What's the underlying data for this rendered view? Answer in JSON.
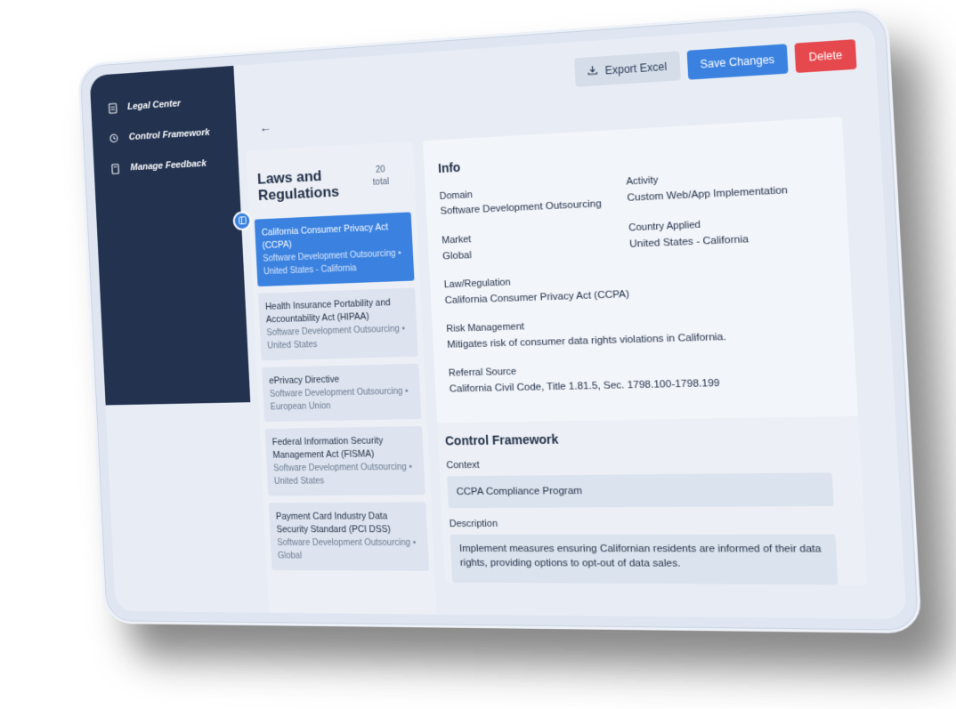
{
  "sidebar": {
    "items": [
      {
        "label": "Legal Center",
        "icon": "document-icon"
      },
      {
        "label": "Control Framework",
        "icon": "history-icon"
      },
      {
        "label": "Manage Feedback",
        "icon": "feedback-icon"
      }
    ]
  },
  "toolbar": {
    "export_label": "Export Excel",
    "save_label": "Save Changes",
    "delete_label": "Delete"
  },
  "laws": {
    "title": "Laws and Regulations",
    "count": "20",
    "count_suffix": "total",
    "items": [
      {
        "name": "California Consumer Privacy Act (CCPA)",
        "meta": "Software Development Outsourcing • United States - California",
        "active": true
      },
      {
        "name": "Health Insurance Portability and Accountability Act (HIPAA)",
        "meta": "Software Development Outsourcing • United States",
        "active": false
      },
      {
        "name": "ePrivacy Directive",
        "meta": "Software Development Outsourcing • European Union",
        "active": false
      },
      {
        "name": "Federal Information Security Management Act (FISMA)",
        "meta": "Software Development Outsourcing • United States",
        "active": false
      },
      {
        "name": "Payment Card Industry Data Security Standard (PCI DSS)",
        "meta": "Software Development Outsourcing • Global",
        "active": false
      }
    ]
  },
  "info": {
    "title": "Info",
    "domain_label": "Domain",
    "domain_value": "Software Development Outsourcing",
    "activity_label": "Activity",
    "activity_value": "Custom Web/App Implementation",
    "market_label": "Market",
    "market_value": "Global",
    "country_label": "Country Applied",
    "country_value": "United States - California",
    "law_label": "Law/Regulation",
    "law_value": "California Consumer Privacy Act (CCPA)",
    "risk_label": "Risk Management",
    "risk_value": "Mitigates risk of consumer data rights violations in California.",
    "referral_label": "Referral Source",
    "referral_value": "California Civil Code, Title 1.81.5, Sec. 1798.100-1798.199"
  },
  "control_framework": {
    "title": "Control Framework",
    "context_label": "Context",
    "context_value": "CCPA Compliance Program",
    "description_label": "Description",
    "description_value": "Implement measures ensuring Californian residents are informed of their data rights, providing options to opt-out of data sales."
  },
  "colors": {
    "sidebar": "#22324f",
    "accent": "#3b82e0",
    "danger": "#e5484d"
  }
}
